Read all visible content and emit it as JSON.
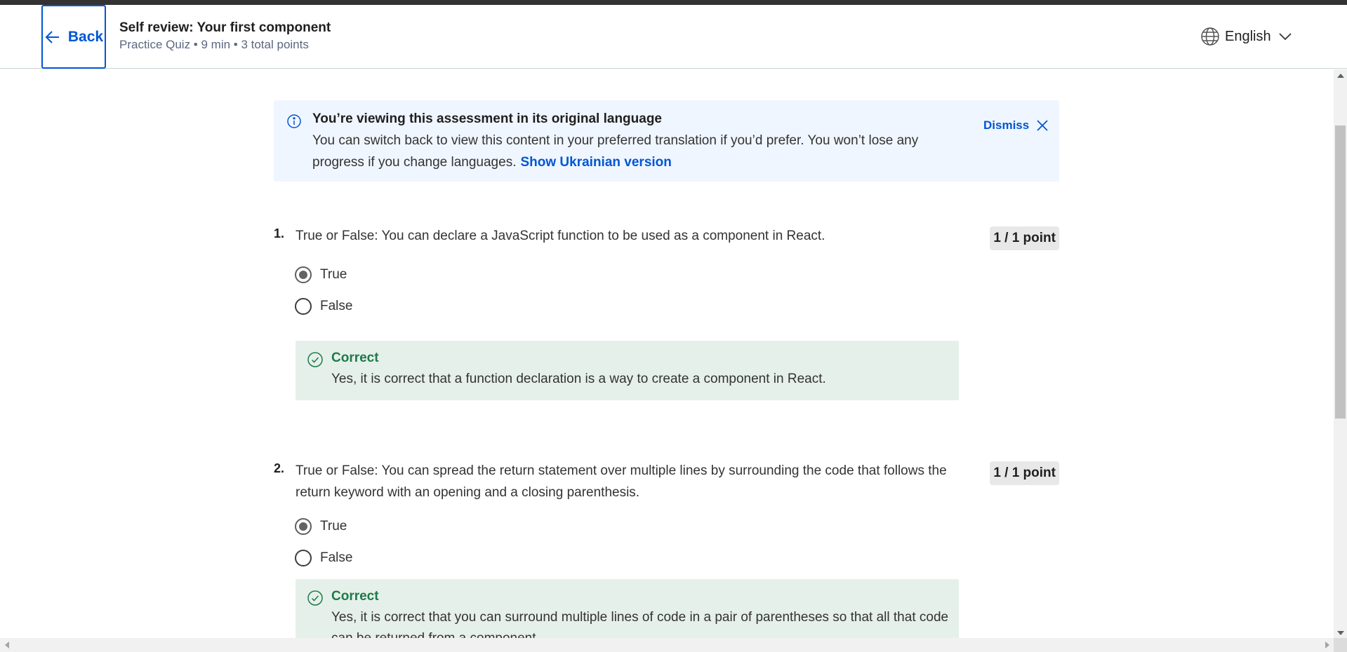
{
  "header": {
    "back_label": "Back",
    "title": "Self review: Your first component",
    "subtitle": "Practice Quiz • 9 min • 3 total points",
    "language": "English"
  },
  "banner": {
    "title": "You’re viewing this assessment in its original language",
    "text": "You can switch back to view this content in your preferred translation if you’d prefer. You won’t lose any progress if you change languages.",
    "link": "Show Ukrainian version",
    "dismiss_label": "Dismiss"
  },
  "questions": [
    {
      "number": "1.",
      "text": "True or False: You can declare a JavaScript function to be used as a component in React.",
      "points": "1 / 1 point",
      "options": [
        {
          "label": "True",
          "selected": true
        },
        {
          "label": "False",
          "selected": false
        }
      ],
      "feedback": {
        "title": "Correct",
        "text": "Yes, it is correct that a function declaration is a way to create a component in React."
      }
    },
    {
      "number": "2.",
      "text": "True or False: You can spread the return statement over multiple lines by surrounding the code that follows the return keyword with an opening and a closing parenthesis.",
      "points": "1 / 1 point",
      "options": [
        {
          "label": "True",
          "selected": true
        },
        {
          "label": "False",
          "selected": false
        }
      ],
      "feedback": {
        "title": "Correct",
        "text": "Yes, it is correct that you can surround multiple lines of code in a pair of parentheses so that all that code can be returned from a component."
      }
    }
  ],
  "icons": {
    "back": "arrow-left-icon",
    "language": "globe-icon",
    "language_menu": "chevron-down-icon",
    "banner": "info-icon",
    "dismiss": "close-icon",
    "feedback": "check-circle-icon"
  },
  "colors": {
    "accent": "#0056d2",
    "banner_bg": "#f0f6ff",
    "correct_bg": "#e6f0ea",
    "correct_text": "#1e7a49",
    "points_bg": "#e8e8e8"
  }
}
